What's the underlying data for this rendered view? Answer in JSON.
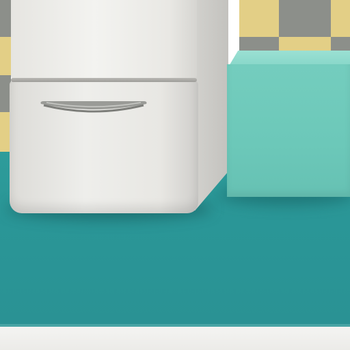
{
  "scene": {
    "subject": "kitchen-corner",
    "colors": {
      "floor": "#2a9697",
      "wall_tile_yellow": "#e3cf86",
      "wall_tile_gray": "#8c8f8a",
      "fridge_body": "#ecebe8",
      "cabinet_block": "#6ec9bb",
      "baseboard": "#f2f2f0"
    },
    "objects": [
      "white-retro-fridge",
      "mint-cabinet-block",
      "checkered-wall-tiles",
      "teal-floor",
      "white-baseboard"
    ]
  }
}
